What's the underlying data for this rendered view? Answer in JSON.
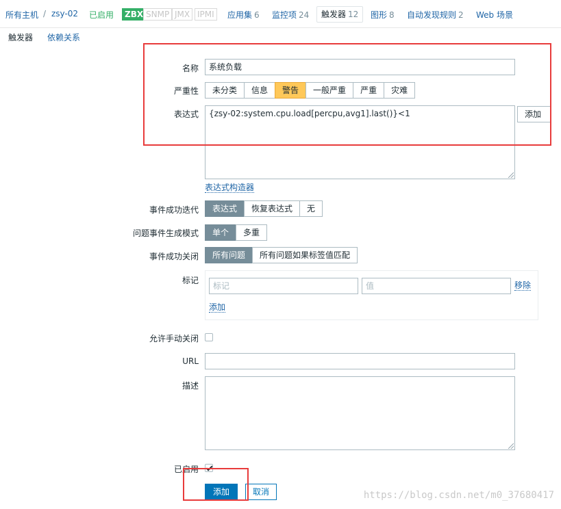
{
  "breadcrumb": {
    "all_hosts": "所有主机",
    "separator": "/",
    "host": "zsy-02",
    "status": "已启用",
    "protocols": [
      "ZBX",
      "SNMP",
      "JMX",
      "IPMI"
    ]
  },
  "nav": {
    "applications": {
      "label": "应用集",
      "count": "6"
    },
    "items": {
      "label": "监控项",
      "count": "24"
    },
    "triggers": {
      "label": "触发器",
      "count": "12"
    },
    "graphs": {
      "label": "图形",
      "count": "8"
    },
    "discovery": {
      "label": "自动发现规则",
      "count": "2"
    },
    "web": {
      "label": "Web 场景"
    }
  },
  "tabs": {
    "trigger": "触发器",
    "dependencies": "依赖关系"
  },
  "form": {
    "name": {
      "label": "名称",
      "value": "系统负载"
    },
    "severity": {
      "label": "严重性",
      "options": [
        "未分类",
        "信息",
        "警告",
        "一般严重",
        "严重",
        "灾难"
      ],
      "selected": "警告",
      "selected_color": "#ffc859"
    },
    "expression": {
      "label": "表达式",
      "value": "{zsy-02:system.cpu.load[percpu,avg1].last()}<1",
      "add_button": "添加",
      "constructor_link": "表达式构造器"
    },
    "ok_event_generation": {
      "label": "事件成功迭代",
      "options": [
        "表达式",
        "恢复表达式",
        "无"
      ],
      "selected": "表达式"
    },
    "problem_event_mode": {
      "label": "问题事件生成模式",
      "options": [
        "单个",
        "多重"
      ],
      "selected": "单个"
    },
    "ok_event_closes": {
      "label": "事件成功关闭",
      "options": [
        "所有问题",
        "所有问题如果标签值匹配"
      ],
      "selected": "所有问题"
    },
    "tags": {
      "label": "标记",
      "tag_placeholder": "标记",
      "value_placeholder": "值",
      "remove": "移除",
      "add": "添加"
    },
    "manual_close": {
      "label": "允许手动关闭",
      "checked": false
    },
    "url": {
      "label": "URL",
      "value": ""
    },
    "description": {
      "label": "描述",
      "value": ""
    },
    "enabled": {
      "label": "已启用",
      "checked": true
    },
    "buttons": {
      "add": "添加",
      "cancel": "取消"
    }
  },
  "colors": {
    "accent": "#0275b8",
    "enabled_green": "#34af67",
    "annotation_red": "#e83b3b"
  },
  "watermark": "https://blog.csdn.net/m0_37680417"
}
